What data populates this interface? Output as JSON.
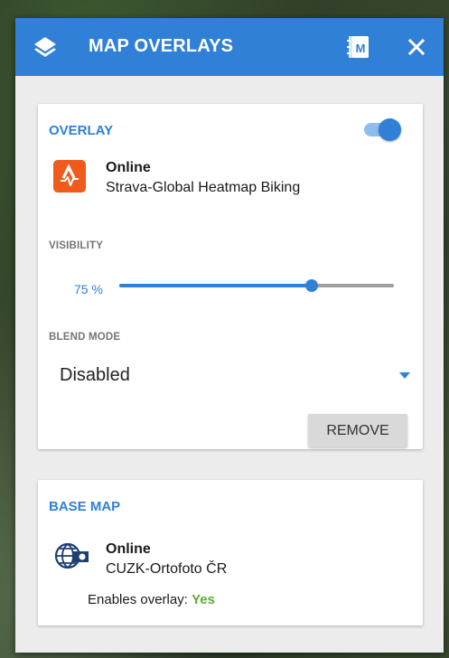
{
  "header": {
    "title": "MAP OVERLAYS",
    "book_badge": "M"
  },
  "overlay_card": {
    "section_title": "OVERLAY",
    "enabled": true,
    "source_type": "Online",
    "source_name": "Strava-Global Heatmap Biking",
    "visibility_label": "VISIBILITY",
    "visibility_value": "75 %",
    "visibility_level": 0.7,
    "blend_mode_label": "BLEND MODE",
    "blend_mode_value": "Disabled",
    "remove_label": "REMOVE"
  },
  "base_map_card": {
    "section_title": "BASE MAP",
    "source_type": "Online",
    "source_name": "CUZK-Ortofoto ČR",
    "enables_overlay_label": "Enables overlay:",
    "enables_overlay_value": "Yes"
  },
  "colors": {
    "accent": "#2f80d6",
    "strava": "#f05a1c",
    "positive": "#5cae2e"
  }
}
